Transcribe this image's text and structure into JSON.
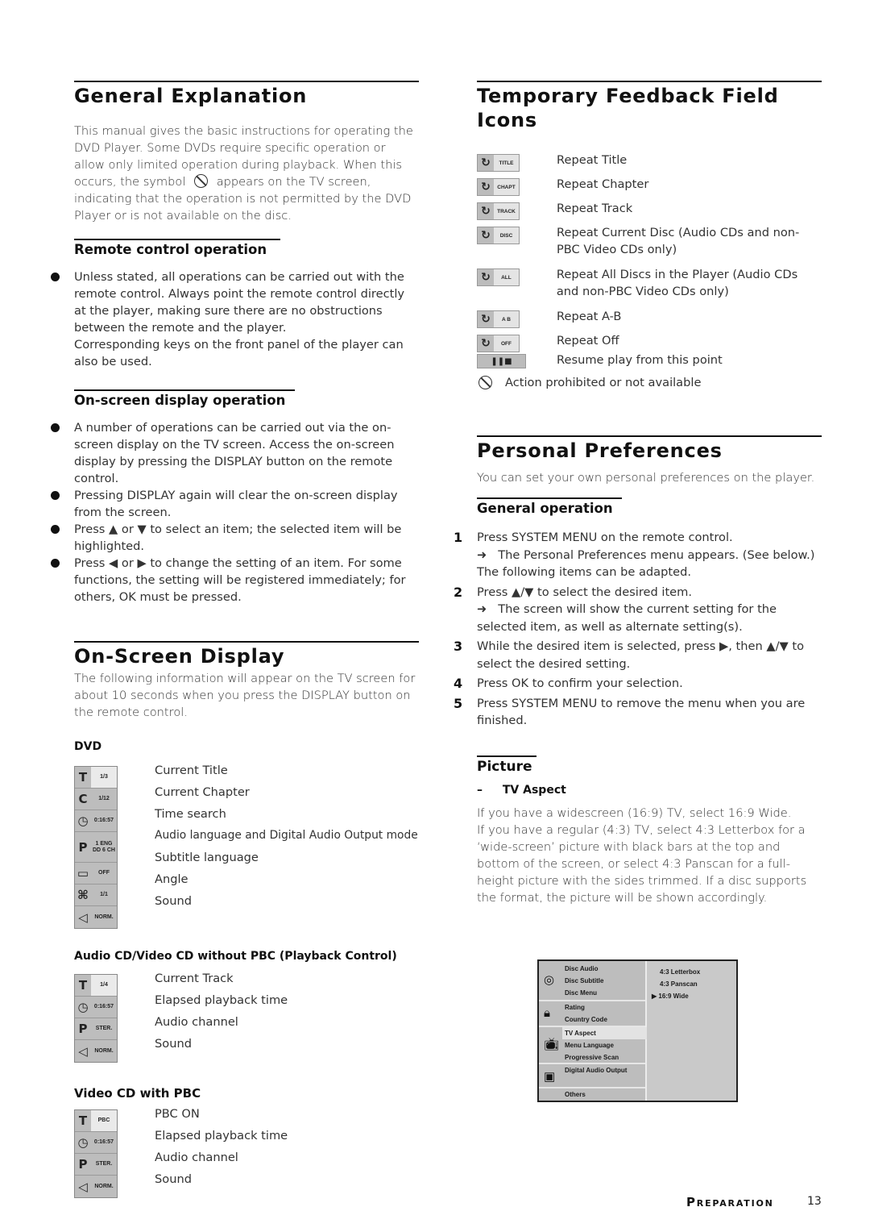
{
  "left": {
    "general": {
      "title": "General Explanation",
      "para_a": "This manual gives the basic instructions for operating the DVD Player. Some DVDs require specific operation or allow only limited operation during playback. When this occurs, the symbol",
      "para_b": "appears on the TV screen, indicating that the operation is not permitted by the DVD Player or is not available on the disc.",
      "symbol_icon": "prohibited-icon"
    },
    "remote": {
      "title": "Remote control operation",
      "bullets": [
        "Unless stated, all operations can be carried out with the remote control. Always point the remote control directly at the player, making sure there are no obstructions between the remote and the player.\nCorresponding keys on the front panel of the player can also be used."
      ],
      "bullet_main": "Unless stated, all operations can be carried out with the remote control. Always point the remote control directly at the player, making sure there are no obstructions between the remote and the player.",
      "bullet_extra": "Corresponding keys on the front panel of the player can also be used."
    },
    "osd_operation": {
      "title": "On-screen display operation",
      "bullets": [
        "A number of operations can be carried out via the on-screen display on the TV screen. Access the on-screen display by pressing the DISPLAY button on the remote control.",
        "Pressing DISPLAY again will clear the on-screen display from the screen.",
        "Press ▲ or ▼ to select an item; the selected item will be highlighted.",
        "Press ◀ or ▶ to change the setting of an item. For some functions, the setting will be registered immediately; for others, OK must be pressed."
      ]
    },
    "osd": {
      "title": "On-Screen Display",
      "intro": "The following information will appear on the TV screen for about 10 seconds when you press the DISPLAY button on the remote control.",
      "dvd": {
        "heading": "DVD",
        "rows": [
          {
            "icon": "title-icon",
            "glyph": "T",
            "value": "1/3",
            "label": "Current Title"
          },
          {
            "icon": "chapter-icon",
            "glyph": "C",
            "value": "1/12",
            "label": "Current Chapter"
          },
          {
            "icon": "clock-icon",
            "glyph": "◷",
            "value": "0:16:57",
            "label": "Time search"
          },
          {
            "icon": "audio-icon",
            "glyph": "P",
            "value": "1 ENG DD 6 CH",
            "label": "Audio language and Digital Audio Output mode"
          },
          {
            "icon": "subtitle-icon",
            "glyph": "▭",
            "value": "OFF",
            "label": "Subtitle language"
          },
          {
            "icon": "camera-icon",
            "glyph": "⌘",
            "value": "1/1",
            "label": "Angle"
          },
          {
            "icon": "speaker-icon",
            "glyph": "◁",
            "value": "NORM.",
            "label": "Sound"
          }
        ]
      },
      "cd": {
        "heading": "Audio CD/Video CD without PBC (Playback Control)",
        "rows": [
          {
            "icon": "track-icon",
            "glyph": "T",
            "value": "1/4",
            "label": "Current Track"
          },
          {
            "icon": "clock-icon",
            "glyph": "◷",
            "value": "0:16:57",
            "label": "Elapsed playback time"
          },
          {
            "icon": "audio-icon",
            "glyph": "P",
            "value": "STER.",
            "label": "Audio channel"
          },
          {
            "icon": "speaker-icon",
            "glyph": "◁",
            "value": "NORM.",
            "label": "Sound"
          }
        ]
      },
      "vcd": {
        "heading": "Video CD with PBC",
        "rows": [
          {
            "icon": "track-icon",
            "glyph": "T",
            "value": "PBC",
            "label": "PBC ON"
          },
          {
            "icon": "clock-icon",
            "glyph": "◷",
            "value": "0:16:57",
            "label": "Elapsed playback time"
          },
          {
            "icon": "audio-icon",
            "glyph": "P",
            "value": "STER.",
            "label": "Audio channel"
          },
          {
            "icon": "speaker-icon",
            "glyph": "◁",
            "value": "NORM.",
            "label": "Sound"
          }
        ]
      }
    }
  },
  "right": {
    "feedback": {
      "title_line1": "Temporary Feedback Field",
      "title_line2": "Icons",
      "rows": [
        {
          "icon": "repeat-icon",
          "value": "TITLE",
          "label": "Repeat Title"
        },
        {
          "icon": "repeat-icon",
          "value": "CHAPT",
          "label": "Repeat Chapter"
        },
        {
          "icon": "repeat-icon",
          "value": "TRACK",
          "label": "Repeat Track"
        },
        {
          "icon": "repeat-icon",
          "value": "DISC",
          "label": "Repeat Current Disc (Audio CDs and non-PBC Video CDs only)"
        },
        {
          "icon": "repeat-icon",
          "value": "ALL",
          "label": "Repeat All Discs in the Player (Audio CDs and non-PBC Video CDs only)"
        },
        {
          "icon": "repeat-ab-icon",
          "value": "A  B",
          "label": "Repeat A-B"
        },
        {
          "icon": "repeat-icon",
          "value": "OFF",
          "label": "Repeat Off"
        }
      ],
      "resume": {
        "icon": "resume-icon",
        "glyph": "❚❚■",
        "label": "Resume play from this point"
      },
      "prohibited": {
        "icon": "prohibited-icon",
        "label": "Action prohibited or not available"
      }
    },
    "prefs": {
      "title": "Personal Preferences",
      "intro": "You can set your own personal preferences on the player.",
      "general": {
        "title": "General operation",
        "steps": [
          {
            "num": "1",
            "text": "Press SYSTEM MENU on the remote control.",
            "arrow": "➜",
            "result": "The Personal Preferences menu appears. (See below.)",
            "extra": "The following items can be adapted."
          },
          {
            "num": "2",
            "text": "Press ▲/▼ to select the desired item.",
            "arrow": "➜",
            "result": "The screen will show the current setting for the selected item, as well as alternate setting(s)."
          },
          {
            "num": "3",
            "text": "While the desired item is selected, press ▶, then ▲/▼ to select the desired setting."
          },
          {
            "num": "4",
            "text": "Press OK to confirm your selection."
          },
          {
            "num": "5",
            "text": "Press SYSTEM MENU to remove the menu when you are finished."
          }
        ]
      },
      "picture": {
        "title": "Picture",
        "sub": "TV Aspect",
        "dash": "–",
        "text1": "If you have a widescreen (16:9) TV, select 16:9 Wide.",
        "text2": "If you have a regular (4:3) TV, select 4:3 Letterbox for a ‘wide-screen’ picture with black bars at the top and bottom of the screen, or select 4:3 Panscan for a full-height picture with the sides trimmed. If a disc supports the format, the picture will be shown accordingly."
      },
      "menu": {
        "groups": [
          {
            "icon": "disc-icon",
            "items": [
              "Disc Audio",
              "Disc Subtitle",
              "Disc Menu"
            ]
          },
          {
            "icon": "lock-icon",
            "items": [
              "Rating",
              "Country Code"
            ]
          },
          {
            "icon": "tv-icon",
            "items": [
              "TV Aspect",
              "Menu Language",
              "Progressive Scan"
            ]
          },
          {
            "icon": "speaker-box-icon",
            "items": [
              "Digital Audio Output"
            ]
          },
          {
            "icon": "",
            "items": [
              "Others"
            ]
          }
        ],
        "selected_item": "TV Aspect",
        "options": [
          "4:3 Letterbox",
          "4:3 Panscan",
          "16:9 Wide"
        ],
        "current_option": "16:9 Wide",
        "current_marker": "▶"
      }
    }
  },
  "footer": {
    "section": "Preparation",
    "page": "13"
  }
}
